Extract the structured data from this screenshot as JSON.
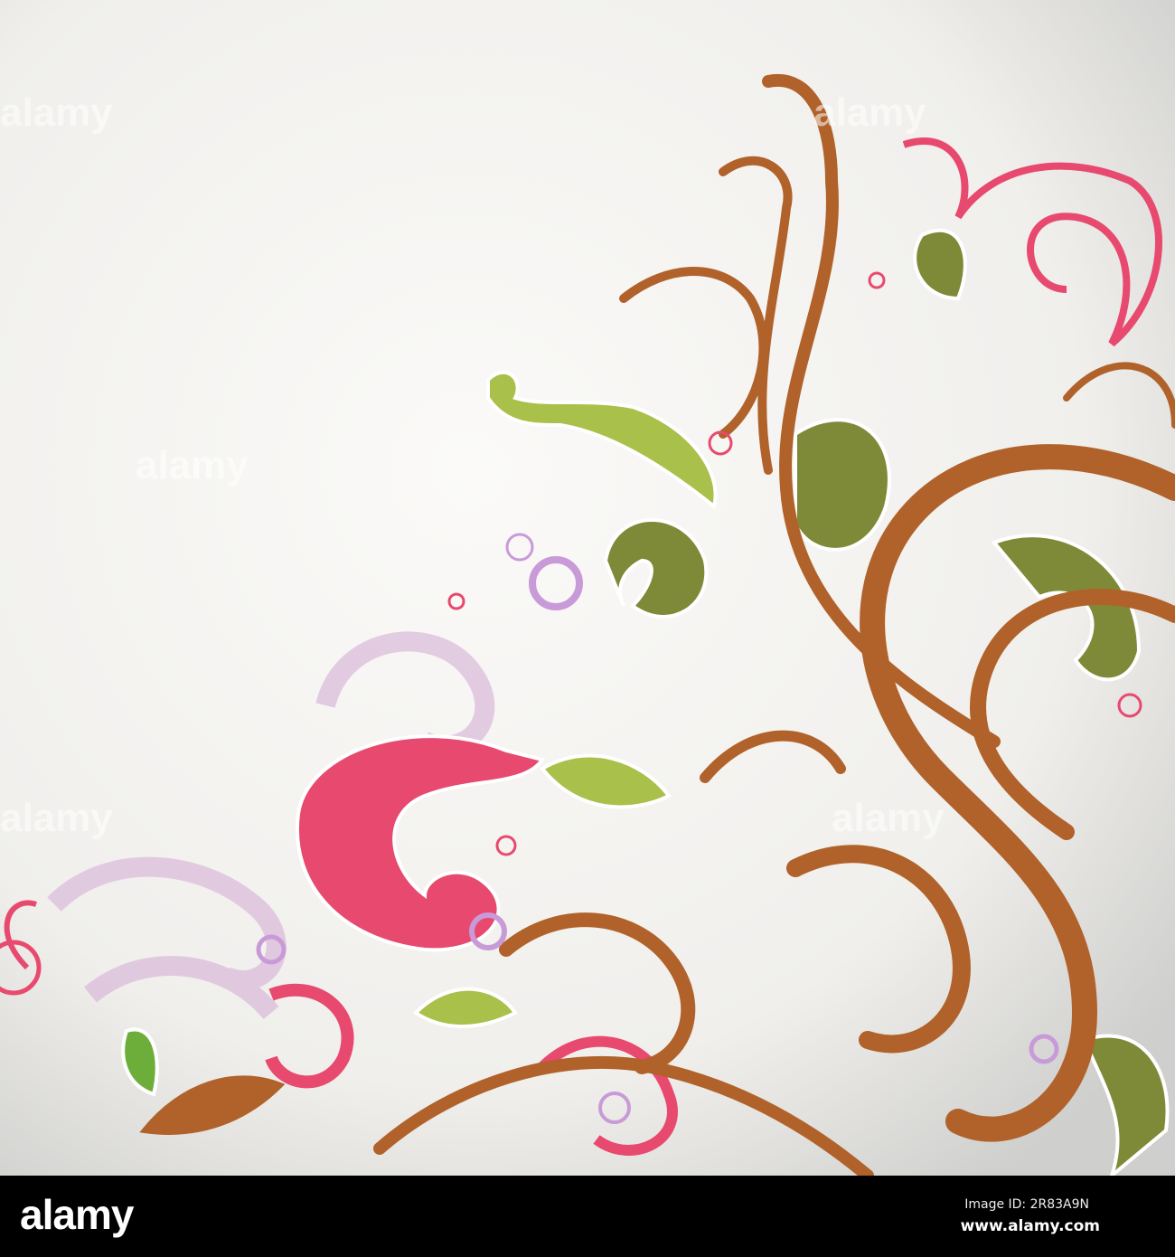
{
  "image": {
    "subject": "Floral swirl ornament",
    "colors": {
      "brown": "#b0622a",
      "green": "#7e8a38",
      "lime": "#a9c04a",
      "pink": "#e8496e",
      "lilac": "#d9b6d8",
      "background": "#f4f3f0"
    }
  },
  "watermark": {
    "text": "alamy"
  },
  "footer": {
    "logo": "alamy",
    "image_id": "Image ID: 2R83A9N",
    "site": "www.alamy.com"
  }
}
